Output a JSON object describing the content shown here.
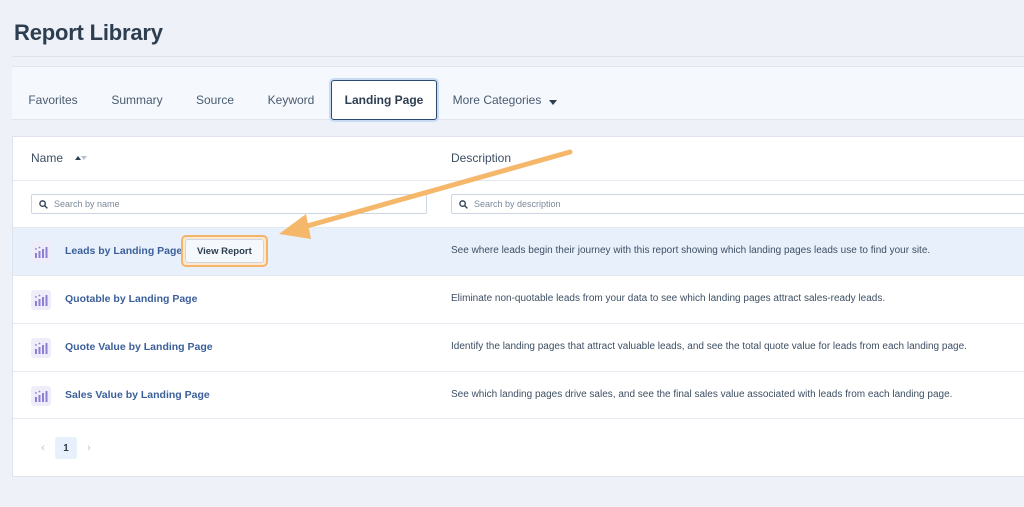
{
  "page": {
    "title": "Report Library"
  },
  "tabs": [
    {
      "label": "Favorites",
      "active": false
    },
    {
      "label": "Summary",
      "active": false
    },
    {
      "label": "Source",
      "active": false
    },
    {
      "label": "Keyword",
      "active": false
    },
    {
      "label": "Landing Page",
      "active": true
    },
    {
      "label": "More Categories",
      "active": false,
      "has_dropdown": true
    }
  ],
  "table": {
    "columns": {
      "name": "Name",
      "description": "Description"
    },
    "search": {
      "name_placeholder": "Search by name",
      "description_placeholder": "Search by description"
    },
    "rows": [
      {
        "name": "Leads by Landing Page",
        "description": "See where leads begin their journey with this report showing which landing pages leads use to find your site.",
        "highlighted": true,
        "action_label": "View Report"
      },
      {
        "name": "Quotable by Landing Page",
        "description": "Eliminate non-quotable leads from your data to see which landing pages attract sales-ready leads."
      },
      {
        "name": "Quote Value by Landing Page",
        "description": "Identify the landing pages that attract valuable leads, and see the total quote value for leads from each landing page."
      },
      {
        "name": "Sales Value by Landing Page",
        "description": "See which landing pages drive sales, and see the final sales value associated with leads from each landing page."
      }
    ],
    "icon": "bar-chart-icon"
  },
  "pagination": {
    "current_page": "1",
    "prev": "‹",
    "next": "›"
  },
  "colors": {
    "background": "#eef2f8",
    "link": "#3b5f9a",
    "highlight_row": "#e8f0fb",
    "callout_arrow": "#f5b76a",
    "icon_purple": "#8b7fd4"
  }
}
